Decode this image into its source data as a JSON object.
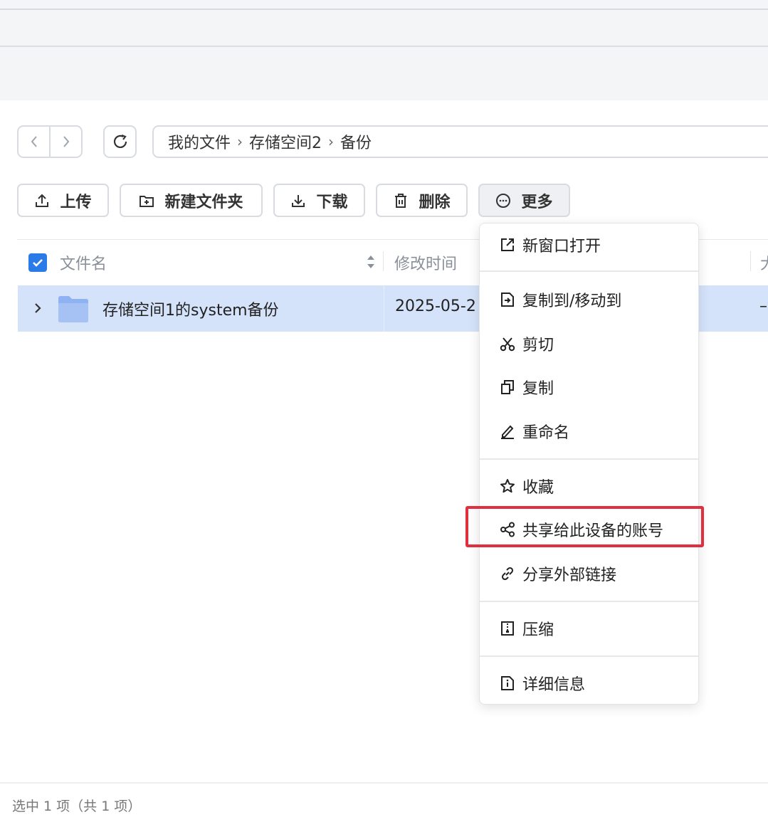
{
  "breadcrumb": {
    "items": [
      "我的文件",
      "存储空间2",
      "备份"
    ],
    "separator": "›"
  },
  "toolbar": {
    "upload": "上传",
    "new_folder": "新建文件夹",
    "download": "下载",
    "delete": "删除",
    "more": "更多"
  },
  "table": {
    "columns": {
      "name": "文件名",
      "modified": "修改时间",
      "size": "大"
    },
    "rows": [
      {
        "name": "存储空间1的system备份",
        "modified": "2025-05-2",
        "size": "–"
      }
    ]
  },
  "menu": {
    "open_new_window": "新窗口打开",
    "copy_move": "复制到/移动到",
    "cut": "剪切",
    "copy": "复制",
    "rename": "重命名",
    "favorite": "收藏",
    "share_device": "共享给此设备的账号",
    "share_link": "分享外部链接",
    "compress": "压缩",
    "details": "详细信息"
  },
  "status": "选中 1 项（共 1 项）",
  "colors": {
    "accent": "#2a7be8",
    "selected_row": "#d5e3fa",
    "highlight": "#e0303f",
    "folder": "#8fb2f2"
  },
  "icons": [
    "chevron-left-icon",
    "chevron-right-icon",
    "refresh-icon",
    "upload-icon",
    "new-folder-icon",
    "download-icon",
    "trash-icon",
    "more-icon",
    "external-link-icon",
    "copy-move-icon",
    "scissors-icon",
    "copy-icon",
    "pencil-icon",
    "star-icon",
    "share-icon",
    "link-icon",
    "archive-icon",
    "info-icon",
    "folder-icon",
    "sort-icon",
    "checkbox-icon"
  ]
}
